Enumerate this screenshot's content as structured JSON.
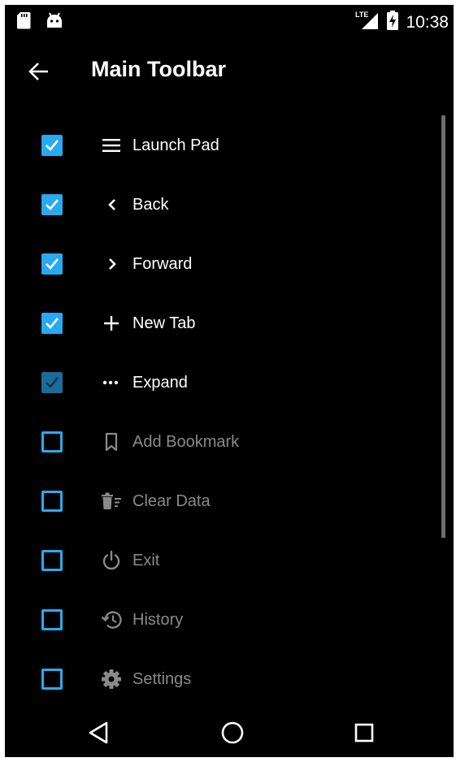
{
  "status_bar": {
    "time": "10:38",
    "network_label": "LTE",
    "left_icons": [
      "sd-card-icon",
      "android-icon"
    ],
    "right_icons": [
      "lte-signal-icon",
      "battery-charging-icon"
    ]
  },
  "toolbar": {
    "title": "Main Toolbar",
    "back_icon": "arrow-back-icon"
  },
  "colors": {
    "background": "#000000",
    "accent": "#29aaf0",
    "enabled_text": "#ffffff",
    "disabled_text": "#8a8a8a"
  },
  "items": [
    {
      "label": "Launch Pad",
      "icon": "menu-icon",
      "checked": true,
      "enabled": true
    },
    {
      "label": "Back",
      "icon": "chevron-left-icon",
      "checked": true,
      "enabled": true
    },
    {
      "label": "Forward",
      "icon": "chevron-right-icon",
      "checked": true,
      "enabled": true
    },
    {
      "label": "New Tab",
      "icon": "plus-icon",
      "checked": true,
      "enabled": true
    },
    {
      "label": "Expand",
      "icon": "more-horizontal-icon",
      "checked": true,
      "enabled": true
    },
    {
      "label": "Add Bookmark",
      "icon": "bookmark-icon",
      "checked": false,
      "enabled": false
    },
    {
      "label": "Clear Data",
      "icon": "trash-icon",
      "checked": false,
      "enabled": false
    },
    {
      "label": "Exit",
      "icon": "power-icon",
      "checked": false,
      "enabled": false
    },
    {
      "label": "History",
      "icon": "history-icon",
      "checked": false,
      "enabled": false
    },
    {
      "label": "Settings",
      "icon": "gear-icon",
      "checked": false,
      "enabled": false
    }
  ],
  "nav_bar": {
    "buttons": [
      "nav-back-icon",
      "nav-home-icon",
      "nav-recents-icon"
    ]
  }
}
